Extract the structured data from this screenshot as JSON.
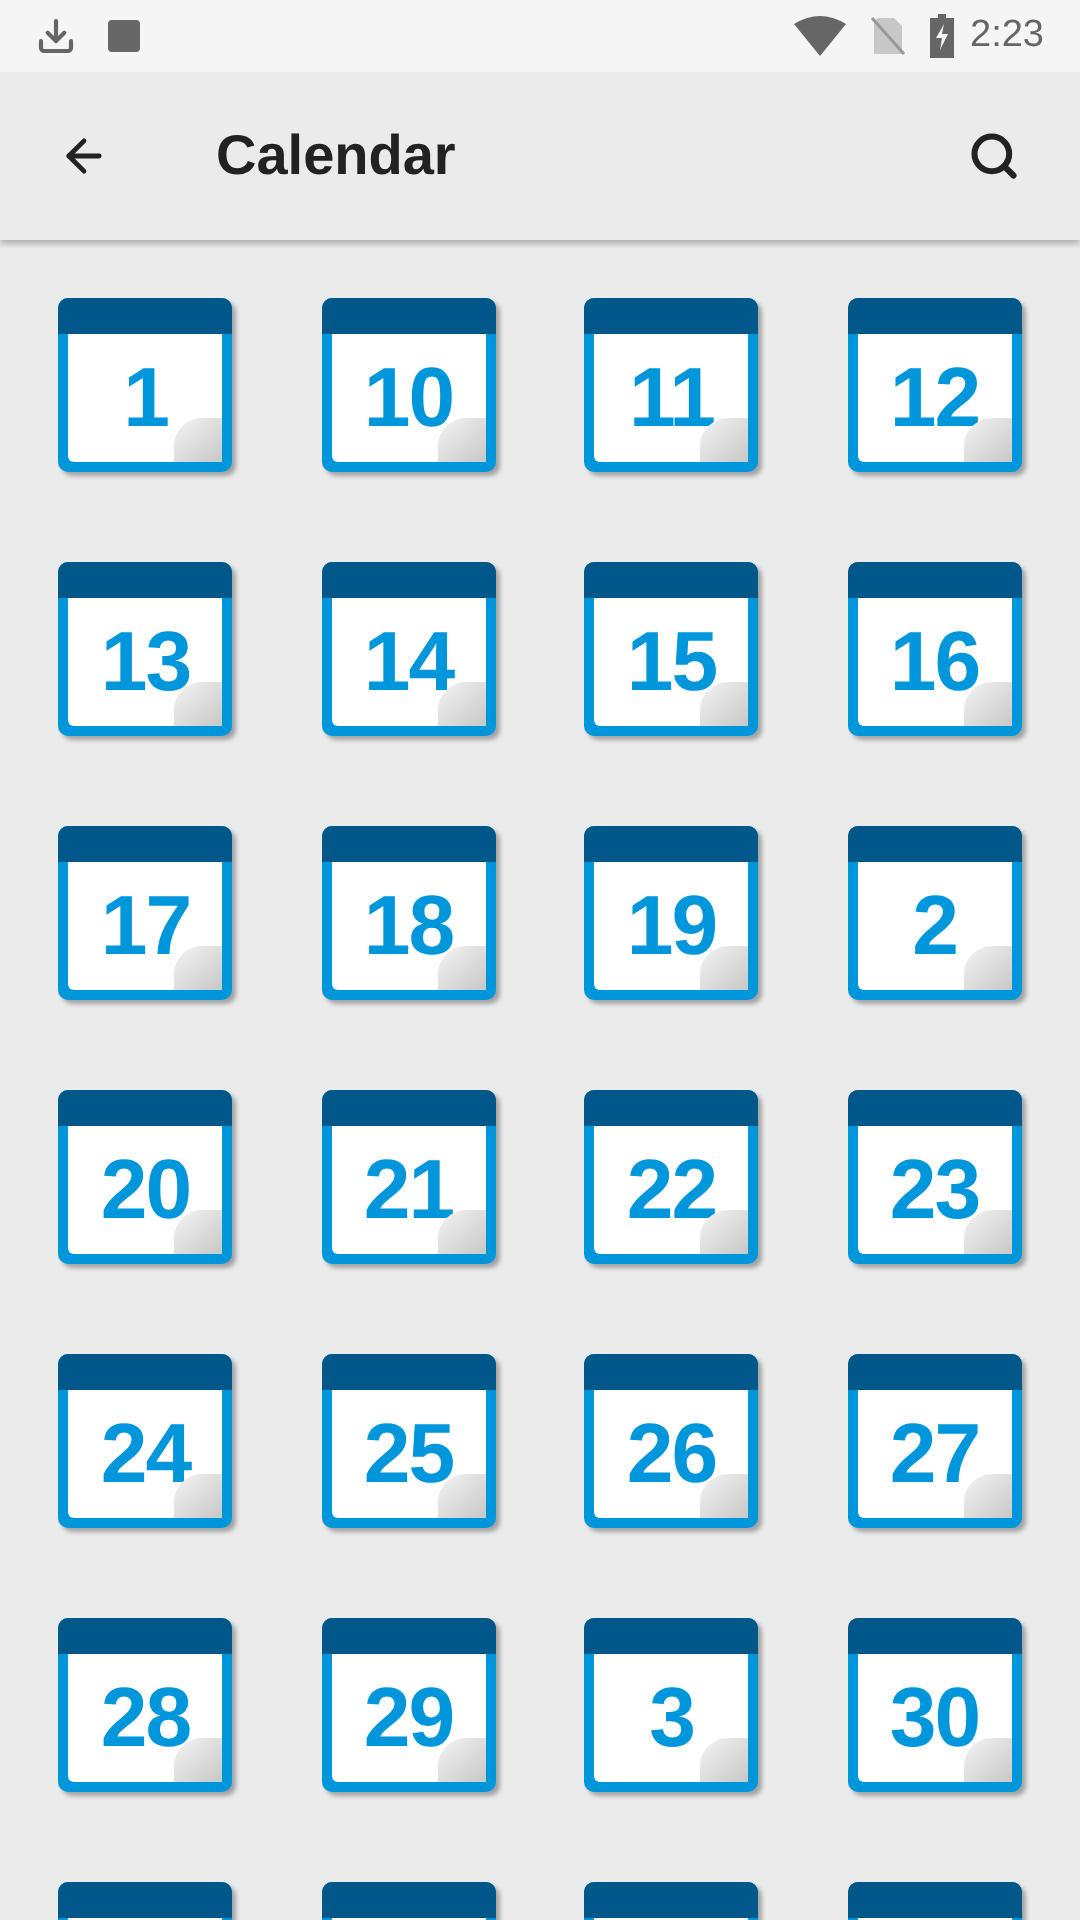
{
  "status_bar": {
    "time": "2:23"
  },
  "app_bar": {
    "title": "Calendar"
  },
  "icons": [
    {
      "label": "1"
    },
    {
      "label": "10"
    },
    {
      "label": "11"
    },
    {
      "label": "12"
    },
    {
      "label": "13"
    },
    {
      "label": "14"
    },
    {
      "label": "15"
    },
    {
      "label": "16"
    },
    {
      "label": "17"
    },
    {
      "label": "18"
    },
    {
      "label": "19"
    },
    {
      "label": "2"
    },
    {
      "label": "20"
    },
    {
      "label": "21"
    },
    {
      "label": "22"
    },
    {
      "label": "23"
    },
    {
      "label": "24"
    },
    {
      "label": "25"
    },
    {
      "label": "26"
    },
    {
      "label": "27"
    },
    {
      "label": "28"
    },
    {
      "label": "29"
    },
    {
      "label": "3"
    },
    {
      "label": "30"
    }
  ]
}
